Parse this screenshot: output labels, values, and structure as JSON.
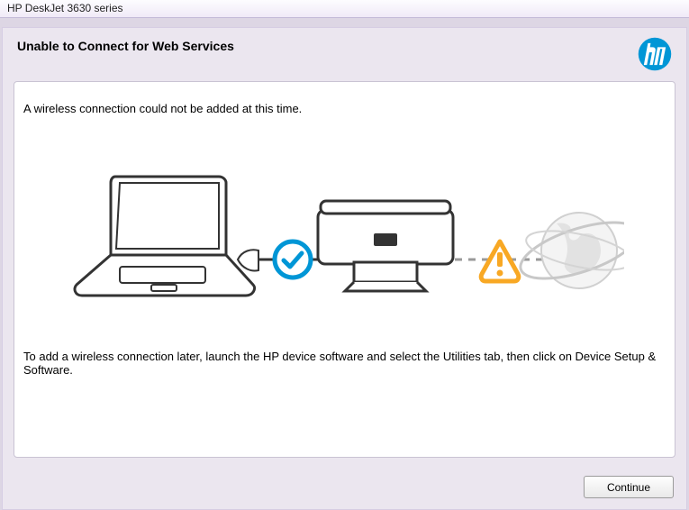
{
  "titlebar": {
    "text": "HP DeskJet 3630 series"
  },
  "header": {
    "title": "Unable to Connect for Web Services"
  },
  "messages": {
    "top": "A wireless connection could not be added at this time.",
    "bottom": "To add a wireless connection later, launch the HP device software and select the Utilities tab, then click on Device Setup & Software."
  },
  "buttons": {
    "continue": "Continue"
  },
  "icons": {
    "laptop": "laptop-icon",
    "printer": "printer-icon",
    "globe": "globe-web-icon",
    "check": "checkmark-circle-icon",
    "warning": "warning-triangle-icon",
    "hp": "hp-logo-icon"
  },
  "colors": {
    "hp_blue": "#0096d6",
    "check_blue": "#0096d6",
    "warning_orange": "#f8a824",
    "line_gray": "#333333",
    "globe_gray": "#d7d7d7"
  }
}
